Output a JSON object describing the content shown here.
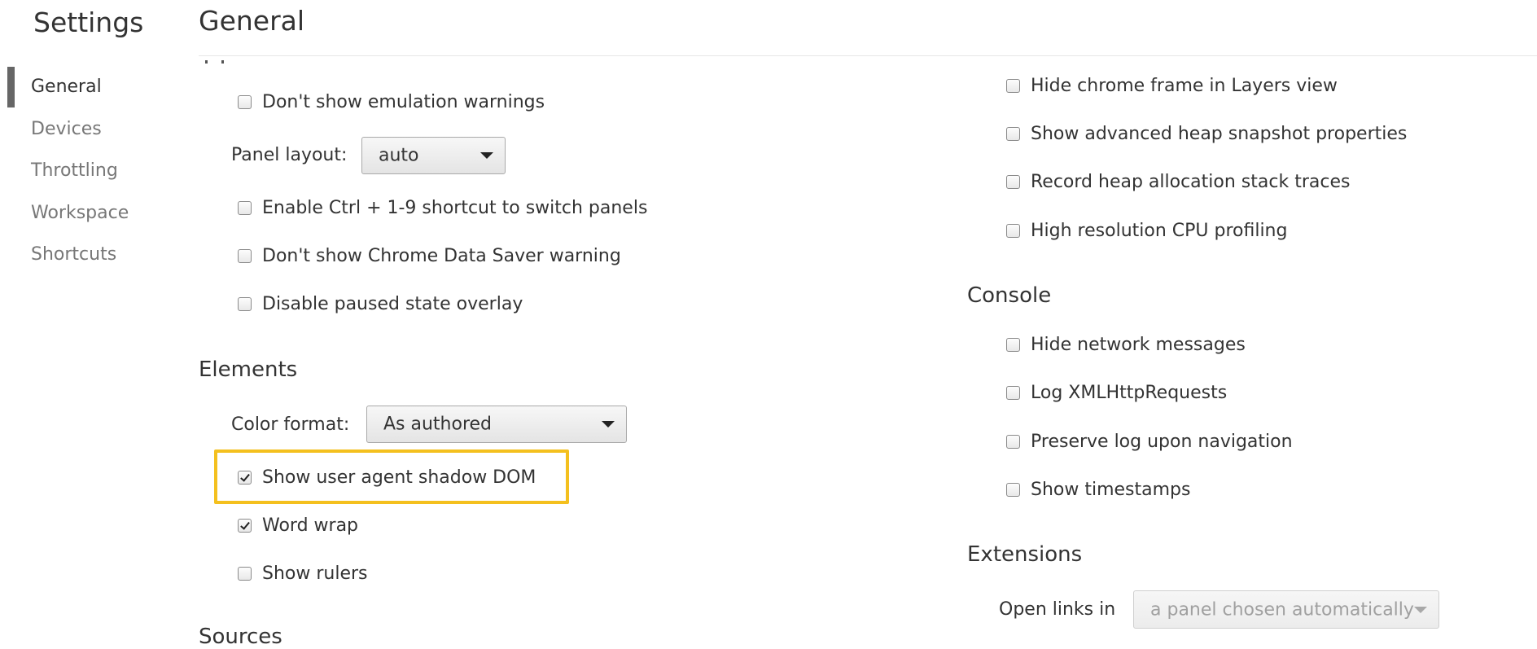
{
  "sidebar": {
    "title": "Settings",
    "items": [
      {
        "label": "General",
        "active": true
      },
      {
        "label": "Devices"
      },
      {
        "label": "Throttling"
      },
      {
        "label": "Workspace"
      },
      {
        "label": "Shortcuts"
      }
    ]
  },
  "header": {
    "title": "General"
  },
  "left": {
    "appearance": {
      "dont_show_emulation_warnings": {
        "label": "Don't show emulation warnings",
        "checked": false
      },
      "panel_layout": {
        "label": "Panel layout:",
        "value": "auto"
      },
      "enable_ctrl_shortcut": {
        "label": "Enable Ctrl + 1-9 shortcut to switch panels",
        "checked": false
      },
      "dont_show_data_saver": {
        "label": "Don't show Chrome Data Saver warning",
        "checked": false
      },
      "disable_paused_overlay": {
        "label": "Disable paused state overlay",
        "checked": false
      }
    },
    "elements": {
      "title": "Elements",
      "color_format": {
        "label": "Color format:",
        "value": "As authored"
      },
      "show_shadow_dom": {
        "label": "Show user agent shadow DOM",
        "checked": true
      },
      "word_wrap": {
        "label": "Word wrap",
        "checked": true
      },
      "show_rulers": {
        "label": "Show rulers",
        "checked": false
      }
    },
    "sources": {
      "title": "Sources"
    }
  },
  "right": {
    "profiler": {
      "hide_chrome_frame": {
        "label": "Hide chrome frame in Layers view",
        "checked": false
      },
      "show_heap_props": {
        "label": "Show advanced heap snapshot properties",
        "checked": false
      },
      "record_heap_traces": {
        "label": "Record heap allocation stack traces",
        "checked": false
      },
      "high_res_cpu": {
        "label": "High resolution CPU profiling",
        "checked": false
      }
    },
    "console": {
      "title": "Console",
      "hide_network": {
        "label": "Hide network messages",
        "checked": false
      },
      "log_xhr": {
        "label": "Log XMLHttpRequests",
        "checked": false
      },
      "preserve_log": {
        "label": "Preserve log upon navigation",
        "checked": false
      },
      "show_timestamps": {
        "label": "Show timestamps",
        "checked": false
      }
    },
    "extensions": {
      "title": "Extensions",
      "open_links": {
        "label": "Open links in",
        "value": "a panel chosen automatically",
        "disabled": true
      }
    }
  },
  "colors": {
    "highlight": "#f4c01e",
    "nav_indicator": "#666666"
  }
}
